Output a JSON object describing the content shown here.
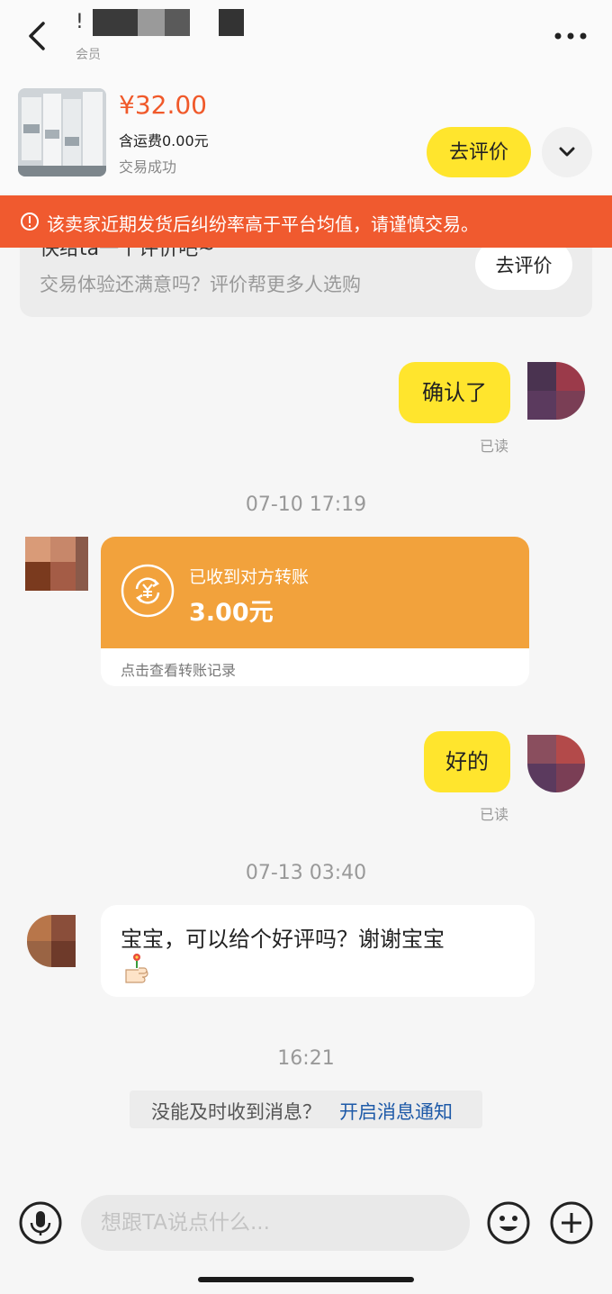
{
  "header": {
    "title": "!",
    "subtitle": "会员",
    "back_icon": "chevron-left-icon",
    "more_icon": "more-horizontal-icon"
  },
  "product": {
    "price": "¥32.00",
    "shipping": "含运费0.00元",
    "status": "交易成功",
    "review_button": "去评价",
    "collapse_icon": "chevron-down-icon"
  },
  "warning": {
    "icon": "alert-circle-icon",
    "text": "该卖家近期发货后纠纷率高于平台均值，请谨慎交易。"
  },
  "evaluation_card": {
    "title": "快给ta一个评价吧~",
    "subtitle": "交易体验还满意吗？评价帮更多人选购",
    "button": "去评价"
  },
  "messages": {
    "m1": {
      "text": "确认了",
      "read": "已读"
    },
    "time1": "07-10 17:19",
    "transfer": {
      "label": "已收到对方转账",
      "amount": "3.00元",
      "link": "点击查看转账记录",
      "icon": "yuan-exchange-icon"
    },
    "m2": {
      "text": "好的",
      "read": "已读"
    },
    "time2": "07-13 03:40",
    "m3": {
      "text": "宝宝，可以给个好评吗？谢谢宝宝"
    },
    "time3": "16:21",
    "notify": {
      "text": "没能及时收到消息？",
      "link": "开启消息通知"
    }
  },
  "input_bar": {
    "placeholder": "想跟TA说点什么...",
    "mic_icon": "microphone-icon",
    "emoji_icon": "emoji-icon",
    "plus_icon": "plus-circle-icon"
  },
  "colors": {
    "accent_yellow": "#ffe52d",
    "price_orange": "#f0592a",
    "warning_bg": "#f05a2f",
    "transfer_orange": "#f2a23c",
    "link_blue": "#1e5aa8"
  }
}
